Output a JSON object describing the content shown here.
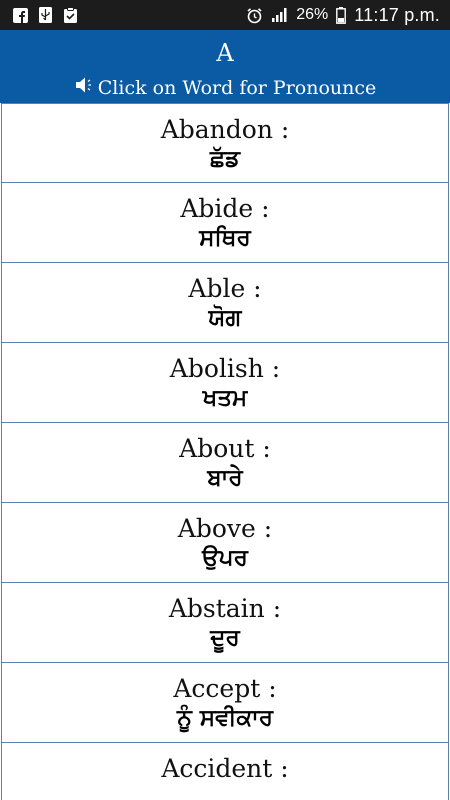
{
  "status_bar": {
    "left_icons": [
      "facebook-icon",
      "usb-icon",
      "clipboard-check-icon"
    ],
    "right_icons": [
      "alarm-icon",
      "signal-icon",
      "battery-icon"
    ],
    "battery": "26%",
    "time": "11:17 p.m."
  },
  "header": {
    "title": "A",
    "subtitle": "Click on Word for Pronounce",
    "subtitle_icon": "speaker-icon",
    "background": "#0a5ba4"
  },
  "words": [
    {
      "english": "Abandon :",
      "punjabi": "ਛੱਡ"
    },
    {
      "english": "Abide :",
      "punjabi": "ਸਥਿਰ"
    },
    {
      "english": "Able :",
      "punjabi": "ਯੋਗ"
    },
    {
      "english": "Abolish :",
      "punjabi": "ਖਤਮ"
    },
    {
      "english": "About :",
      "punjabi": "ਬਾਰੇ"
    },
    {
      "english": "Above :",
      "punjabi": "ਉਪਰ"
    },
    {
      "english": "Abstain :",
      "punjabi": "ਦੂਰ"
    },
    {
      "english": "Accept :",
      "punjabi": "ਨੂੰ ਸਵੀਕਾਰ"
    },
    {
      "english": "Accident :",
      "punjabi": ""
    }
  ]
}
